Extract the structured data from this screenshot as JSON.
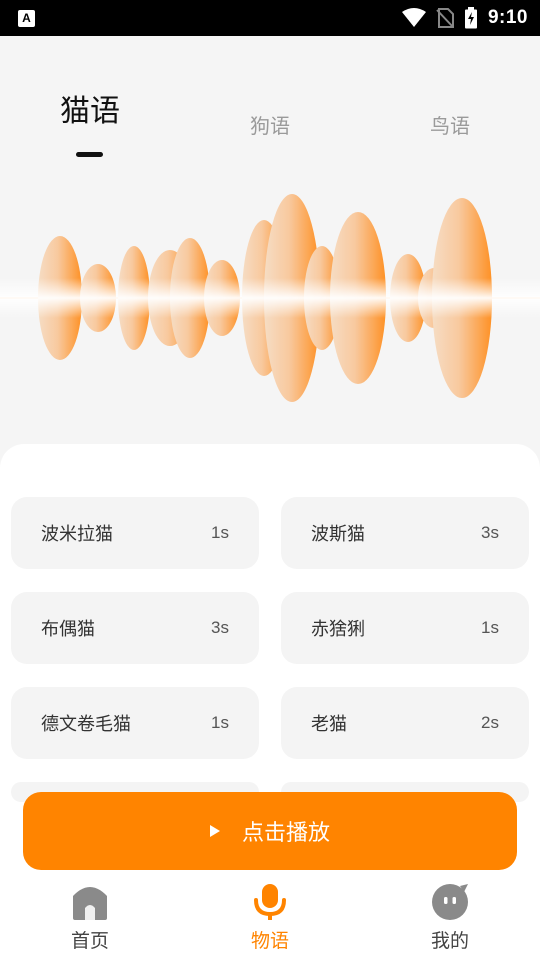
{
  "status_bar": {
    "app_icon_letter": "A",
    "time": "9:10",
    "icons": [
      "wifi-icon",
      "no-sim-icon",
      "battery-charging-icon"
    ]
  },
  "tabs": [
    {
      "label": "猫语",
      "active": true
    },
    {
      "label": "狗语",
      "active": false
    },
    {
      "label": "鸟语",
      "active": false
    }
  ],
  "waveform": {
    "icon": "sound-wave-graphic",
    "color": "#ff8c1a"
  },
  "sounds": [
    {
      "name": "波米拉猫",
      "duration": "1s"
    },
    {
      "name": "波斯猫",
      "duration": "3s"
    },
    {
      "name": "布偶猫",
      "duration": "3s"
    },
    {
      "name": "赤猞猁",
      "duration": "1s"
    },
    {
      "name": "德文卷毛猫",
      "duration": "1s"
    },
    {
      "name": "老猫",
      "duration": "2s"
    }
  ],
  "play_button": {
    "label": "点击播放",
    "icon": "play-icon"
  },
  "bottom_nav": [
    {
      "label": "首页",
      "icon": "home-icon",
      "active": false
    },
    {
      "label": "物语",
      "icon": "microphone-icon",
      "active": true
    },
    {
      "label": "我的",
      "icon": "profile-face-icon",
      "active": false
    }
  ],
  "colors": {
    "accent": "#ff8400",
    "background": "#f5f5f5",
    "card": "#f4f4f4"
  }
}
